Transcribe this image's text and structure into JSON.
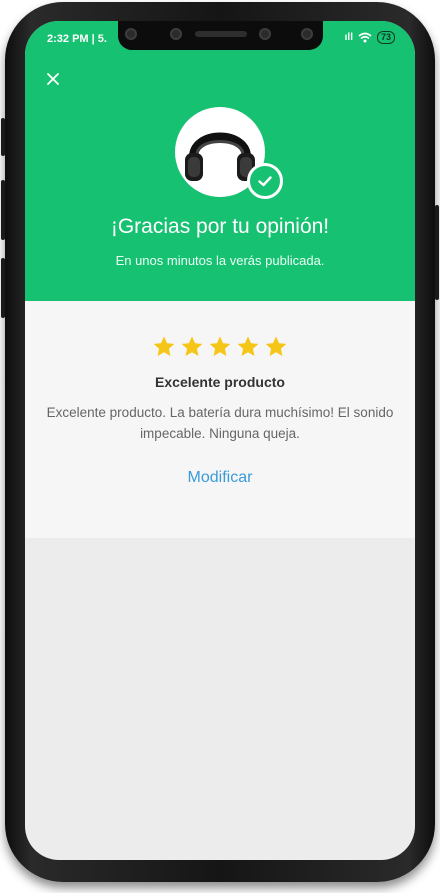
{
  "status_bar": {
    "time": "2:32 PM | 5.",
    "signal": "ıll",
    "battery": "73"
  },
  "header": {
    "close_icon": "close-icon",
    "product_image": "headphones-icon",
    "check_icon": "check-icon",
    "title": "¡Gracias por tu opinión!",
    "subtitle": "En unos minutos la verás publicada."
  },
  "review": {
    "rating": 5,
    "max_rating": 5,
    "title": "Excelente producto",
    "body": "Excelente producto. La batería dura muchísimo! El sonido impecable. Ninguna queja.",
    "edit_label": "Modificar"
  },
  "colors": {
    "brand_green": "#17c172",
    "star": "#f5c518",
    "link": "#3a9bd9"
  }
}
